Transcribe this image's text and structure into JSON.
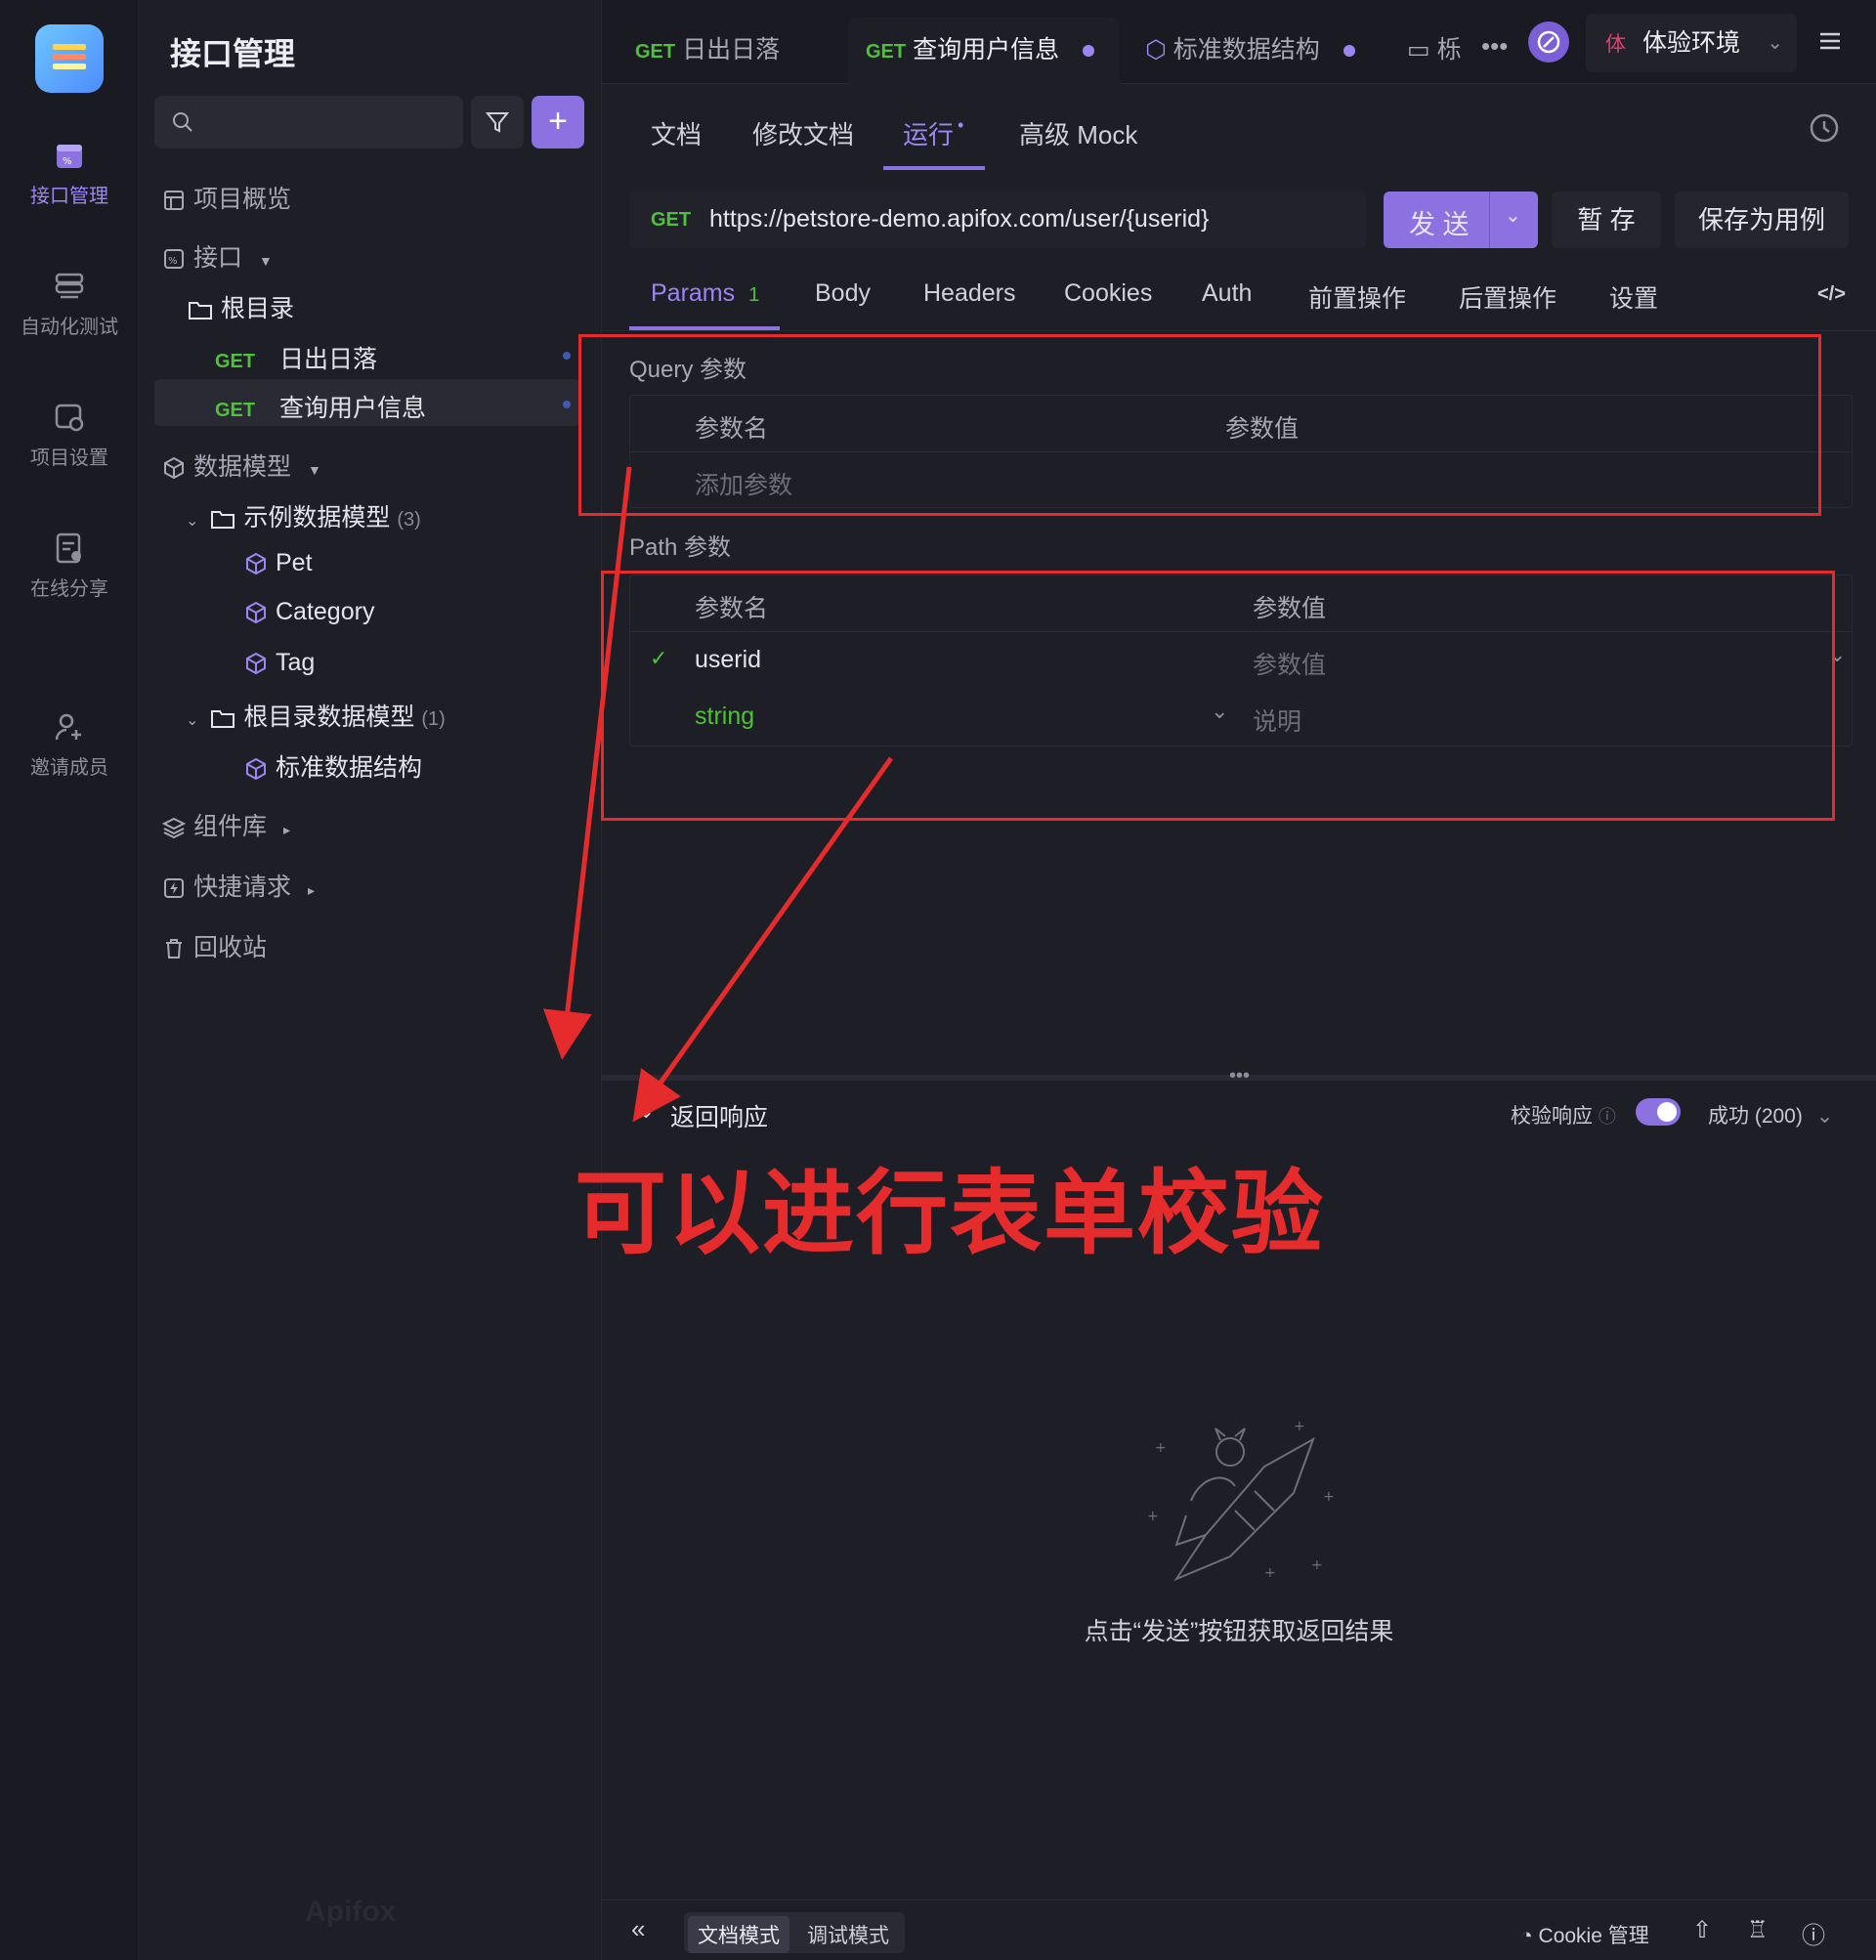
{
  "rail": {
    "items": [
      {
        "label": "接口管理",
        "icon": "api-management-icon",
        "active": true
      },
      {
        "label": "自动化测试",
        "icon": "automation-test-icon"
      },
      {
        "label": "项目设置",
        "icon": "project-settings-icon"
      },
      {
        "label": "在线分享",
        "icon": "online-share-icon"
      },
      {
        "label": "邀请成员",
        "icon": "invite-member-icon"
      }
    ]
  },
  "sidebar": {
    "title": "接口管理",
    "search_placeholder": "",
    "tree": {
      "overview": "项目概览",
      "interfaces": "接口",
      "root_dir": "根目录",
      "endpoints": [
        {
          "method": "GET",
          "name": "日出日落"
        },
        {
          "method": "GET",
          "name": "查询用户信息",
          "selected": true
        }
      ],
      "data_models": "数据模型",
      "example_models_folder": "示例数据模型",
      "example_models_count": "(3)",
      "example_models": [
        "Pet",
        "Category",
        "Tag"
      ],
      "root_models_folder": "根目录数据模型",
      "root_models_count": "(1)",
      "root_models": [
        "标准数据结构"
      ],
      "components": "组件库",
      "quick_requests": "快捷请求",
      "trash": "回收站"
    },
    "watermark": "Apifox"
  },
  "tabs": [
    {
      "method": "GET",
      "label": "日出日落"
    },
    {
      "method": "GET",
      "label": "查询用户信息",
      "active": true
    },
    {
      "label": "标准数据结构"
    },
    {
      "label": "栎"
    }
  ],
  "env": {
    "badge": "体",
    "label": "体验环境"
  },
  "subtabs": [
    "文档",
    "修改文档",
    "运行",
    "高级 Mock"
  ],
  "active_subtab_dot": "•",
  "request": {
    "method": "GET",
    "url": "https://petstore-demo.apifox.com/user/{userid}",
    "send": "发 送",
    "save_temp": "暂 存",
    "save_case": "保存为用例"
  },
  "param_tabs": [
    {
      "label": "Params",
      "badge": "1",
      "active": true
    },
    {
      "label": "Body"
    },
    {
      "label": "Headers"
    },
    {
      "label": "Cookies"
    },
    {
      "label": "Auth"
    },
    {
      "label": "前置操作"
    },
    {
      "label": "后置操作"
    },
    {
      "label": "设置"
    }
  ],
  "query": {
    "title": "Query 参数",
    "col_name": "参数名",
    "col_value": "参数值",
    "add_placeholder": "添加参数"
  },
  "path": {
    "title": "Path 参数",
    "col_name": "参数名",
    "col_value": "参数值",
    "row": {
      "name": "userid",
      "value_placeholder": "参数值",
      "type": "string",
      "desc_placeholder": "说明"
    }
  },
  "response": {
    "title": "返回响应",
    "verify_label": "校验响应",
    "status": "成功 (200)",
    "empty_message": "点击“发送”按钮获取返回结果"
  },
  "annotation": "可以进行表单校验",
  "bottom": {
    "doc_mode": "文档模式",
    "debug_mode": "调试模式",
    "cookie_manage": "Cookie 管理"
  },
  "colors": {
    "accent": "#8b72e0",
    "get_method": "#4fc03a",
    "annotation_red": "#e52b2b"
  }
}
